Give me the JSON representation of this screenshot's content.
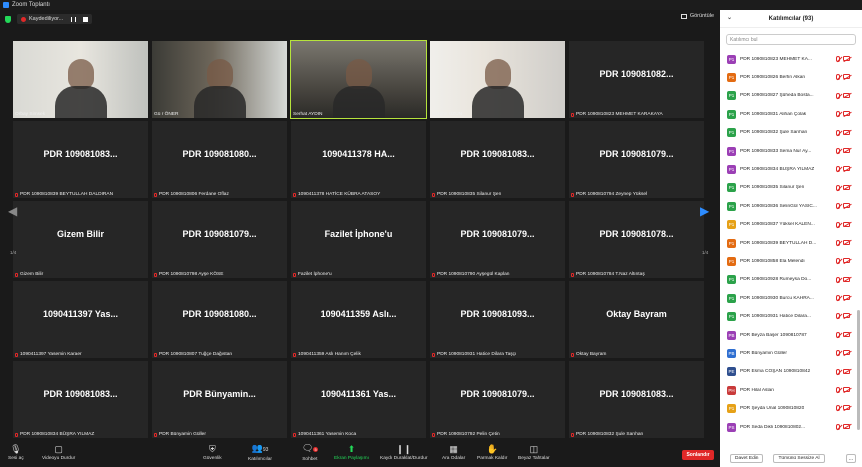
{
  "window": {
    "title": "Zoom Toplantı"
  },
  "topbar": {
    "recording_label": "Kaydediliyor...",
    "view_label": "Görüntüle"
  },
  "grid": {
    "page_left": "1/4",
    "page_right": "1/4",
    "tiles": [
      {
        "big": "",
        "label": "Orbay Simsek",
        "video": "vid-a",
        "muted": false
      },
      {
        "big": "",
        "label": "Gü r ÖNER",
        "video": "vid-b",
        "muted": false
      },
      {
        "big": "",
        "label": "Serhat AYDIN",
        "video": "vid-c",
        "muted": false,
        "active": true
      },
      {
        "big": "",
        "label": "Gülgün UZUN",
        "video": "vid-d",
        "muted": false
      },
      {
        "big": "PDR 109081082...",
        "label": "PDR 1090810823 MEHMET KARAKAYA",
        "muted": true
      },
      {
        "big": "PDR 109081083...",
        "label": "PDR 1090810839 BEYTULLAH DALDIRAN",
        "muted": true
      },
      {
        "big": "PDR 109081080...",
        "label": "PDR 1090810806 Ferdane Oflaz",
        "muted": true
      },
      {
        "big": "1090411378 HA...",
        "label": "1090411378 HATİCE KÜBRA ATASOY",
        "muted": true
      },
      {
        "big": "PDR 109081083...",
        "label": "PDR 1090810835 Silanur Şen",
        "muted": true
      },
      {
        "big": "PDR 109081079...",
        "label": "PDR 1090810794 Zeynep Yüksel",
        "muted": true
      },
      {
        "big": "Gizem Bilir",
        "label": "Gizem Bilir",
        "muted": true
      },
      {
        "big": "PDR 109081079...",
        "label": "PDR 1090810798 Ayşe KÖSE",
        "muted": true
      },
      {
        "big": "Fazilet İphone'u",
        "label": "Fazilet İphone'u",
        "muted": true
      },
      {
        "big": "PDR 109081079...",
        "label": "PDR 1090810790 Ayşegül Kaplan",
        "muted": true
      },
      {
        "big": "PDR 109081078...",
        "label": "PDR 1090810784 T.Naz Altıntaş",
        "muted": true
      },
      {
        "big": "1090411397 Yas...",
        "label": "1090411397 Yasemin Karaer",
        "muted": true
      },
      {
        "big": "PDR 109081080...",
        "label": "PDR 1090810807 Tuğçe Dağıstan",
        "muted": true
      },
      {
        "big": "1090411359 Aslı...",
        "label": "1090411359 Aslı Hanım Çelik",
        "muted": true
      },
      {
        "big": "PDR 109081093...",
        "label": "PDR 1090810931 Hatice Dilara Taşçı",
        "muted": true
      },
      {
        "big": "Oktay Bayram",
        "label": "Oktay Bayram",
        "muted": true
      },
      {
        "big": "PDR 109081083...",
        "label": "PDR 1090810834 BÜŞRA YILMAZ",
        "muted": true
      },
      {
        "big": "PDR Bünyamin...",
        "label": "PDR Bünyamin Güller",
        "muted": true
      },
      {
        "big": "1090411361 Yas...",
        "label": "1090411361 Yasemin Koca",
        "muted": true
      },
      {
        "big": "PDR 109081079...",
        "label": "PDR 1090810792 Pelin Çetin",
        "muted": true
      },
      {
        "big": "PDR 109081083...",
        "label": "PDR 1090810832 Şule Sarıhan",
        "muted": true
      }
    ]
  },
  "toolbar": {
    "audio": "Sesi aç",
    "video": "Videoyu Durdur",
    "security": "Güvenlik",
    "participants": "Katılımcılar",
    "participants_count": "93",
    "chat": "Sohbet",
    "chat_badge": "5",
    "share": "Ekran Paylaşımı",
    "record": "Kaydı Duraklat/Durdur",
    "breakout": "Ara Odalar",
    "reactions": "Parmak Kaldır",
    "whiteboard": "Beyaz Tahtalar",
    "end": "Sonlandır"
  },
  "panel": {
    "title": "Katılımcılar (93)",
    "search_placeholder": "Katılımcı bul",
    "invite": "Davet Edin",
    "mute_all": "Tümünü Sessize Al",
    "more": "...",
    "participants": [
      {
        "initials": "P1",
        "color": "#9b3fb5",
        "name": "PDR 1090810823 MEHMET KA..."
      },
      {
        "initials": "P1",
        "color": "#e36b12",
        "name": "PDR 1090810826 Berfin Alkan"
      },
      {
        "initials": "P1",
        "color": "#2ba24a",
        "name": "PDR 1090810827 Şüheda Bosta..."
      },
      {
        "initials": "P1",
        "color": "#2ba24a",
        "name": "PDR 1090810831 Alihan Çolak"
      },
      {
        "initials": "P1",
        "color": "#2ba24a",
        "name": "PDR 1090810832 Şule Sarıhan"
      },
      {
        "initials": "P1",
        "color": "#9b3fb5",
        "name": "PDR 1090810833 Sema Nur Ay..."
      },
      {
        "initials": "P1",
        "color": "#9b3fb5",
        "name": "PDR 1090810834 BÜŞRA YILMAZ"
      },
      {
        "initials": "P1",
        "color": "#2ba24a",
        "name": "PDR 1090810835 Silanur Şen"
      },
      {
        "initials": "P1",
        "color": "#2ba24a",
        "name": "PDR 1090810836 SelinGül YASIC..."
      },
      {
        "initials": "P1",
        "color": "#e6a117",
        "name": "PDR 1090810837 Yüksel KALEN..."
      },
      {
        "initials": "P1",
        "color": "#e36b12",
        "name": "PDR 1090810839 BEYTULLAH D..."
      },
      {
        "initials": "P1",
        "color": "#e36b12",
        "name": "PDR 1090810858 Ela Melendi"
      },
      {
        "initials": "P1",
        "color": "#2ba24a",
        "name": "PDR 1090810928 Rumeysa Do..."
      },
      {
        "initials": "P1",
        "color": "#2ba24a",
        "name": "PDR 1090810930 Burcu KAHRA..."
      },
      {
        "initials": "P1",
        "color": "#2ba24a",
        "name": "PDR 1090810931 Hatice Dilara..."
      },
      {
        "initials": "PB",
        "color": "#9b3fb5",
        "name": "PDR Beyza Başer 1090810787"
      },
      {
        "initials": "PB",
        "color": "#2f6fd1",
        "name": "PDR Bünyamin Güller"
      },
      {
        "initials": "PE",
        "color": "#2f4f8f",
        "name": "PDR Esma COŞAN 1090810842"
      },
      {
        "initials": "PH",
        "color": "#c93a3a",
        "name": "PDR Hilal Aslan"
      },
      {
        "initials": "P1",
        "color": "#e6a117",
        "name": "PDR Şeyda Ünal 1090810820"
      },
      {
        "initials": "PS",
        "color": "#9b3fb5",
        "name": "PDR Seda Dikli 1090810802..."
      }
    ]
  }
}
